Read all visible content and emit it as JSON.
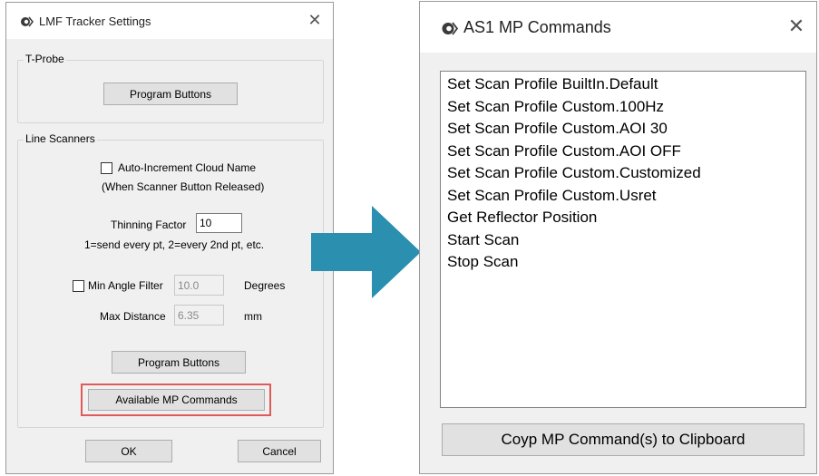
{
  "settings_dialog": {
    "title": "LMF Tracker Settings",
    "close_glyph": "✕",
    "tprobe": {
      "legend": "T-Probe",
      "program_buttons": "Program Buttons"
    },
    "line_scanners": {
      "legend": "Line Scanners",
      "auto_increment_label": "Auto-Increment Cloud Name",
      "auto_increment_sub": "(When Scanner Button Released)",
      "auto_increment_checked": false,
      "thinning_label": "Thinning Factor",
      "thinning_value": "10",
      "thinning_hint": "1=send every pt, 2=every 2nd pt, etc.",
      "min_angle_label": "Min Angle Filter",
      "min_angle_checked": false,
      "min_angle_value": "10.0",
      "min_angle_unit": "Degrees",
      "max_distance_label": "Max Distance",
      "max_distance_value": "6.35",
      "max_distance_unit": "mm",
      "program_buttons": "Program Buttons",
      "available_mp_commands": "Available MP Commands"
    },
    "ok": "OK",
    "cancel": "Cancel"
  },
  "commands_dialog": {
    "title": "AS1 MP Commands",
    "close_glyph": "✕",
    "commands": [
      "Set Scan Profile BuiltIn.Default",
      "Set Scan Profile Custom.100Hz",
      "Set Scan Profile Custom.AOI 30",
      "Set Scan Profile Custom.AOI OFF",
      "Set Scan Profile Custom.Customized",
      "Set Scan Profile Custom.Usret",
      "Get Reflector Position",
      "Start Scan",
      "Stop Scan"
    ],
    "copy_button": "Coyp MP Command(s) to Clipboard"
  },
  "colors": {
    "arrow": "#2b8fb0",
    "highlight": "#e05a5a"
  }
}
